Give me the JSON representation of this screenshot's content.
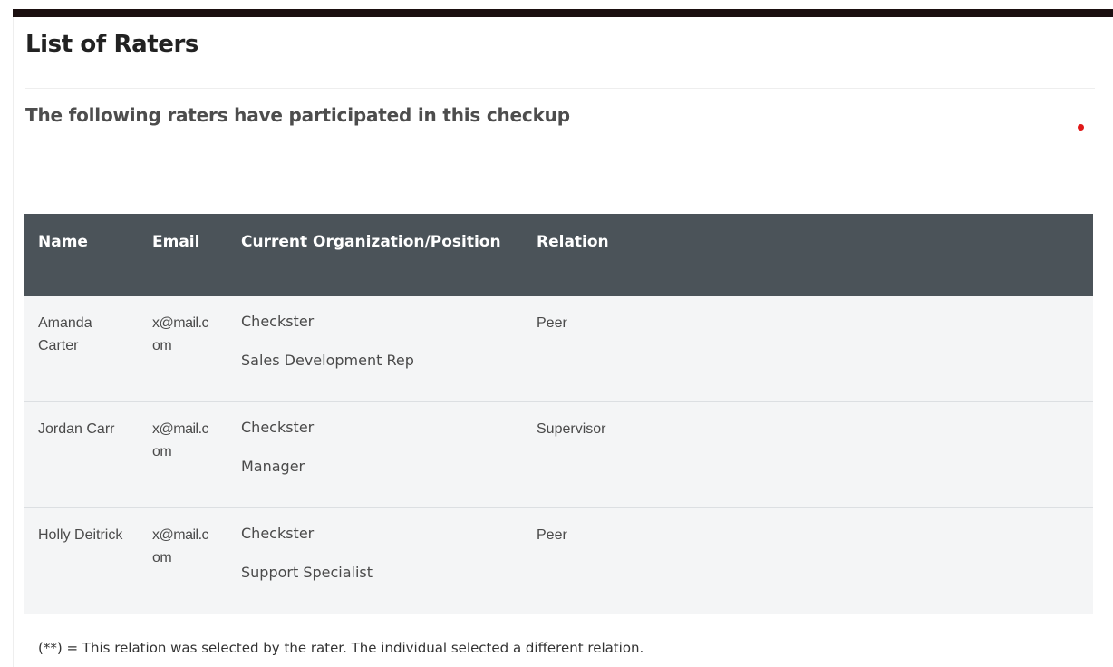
{
  "page": {
    "title": "List of Raters",
    "subtitle": "The following raters have participated in this checkup"
  },
  "table": {
    "headers": [
      "Name",
      "Email",
      "Current Organization/Position",
      "Relation"
    ],
    "rows": [
      {
        "name": "Amanda Carter",
        "email": "x@mail.com",
        "organization": "Checkster",
        "position": "Sales Development Rep",
        "relation": "Peer"
      },
      {
        "name": "Jordan Carr",
        "email": "x@mail.com",
        "organization": "Checkster",
        "position": "Manager",
        "relation": "Supervisor"
      },
      {
        "name": "Holly Deitrick",
        "email": "x@mail.com",
        "organization": "Checkster",
        "position": "Support Specialist",
        "relation": "Peer"
      }
    ]
  },
  "footnote": "(**) = This relation was selected by the rater. The individual selected a different relation.",
  "colors": {
    "header_bg": "#4b5359",
    "row_bg": "#f4f5f6",
    "top_bar": "#1b0f10",
    "indicator": "#e01818"
  },
  "icons": {
    "indicator": "red-dot-indicator"
  }
}
